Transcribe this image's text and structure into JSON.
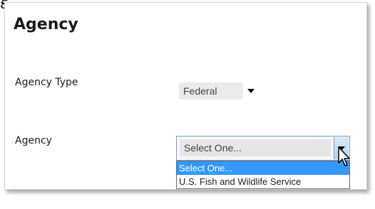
{
  "page": {
    "peek_text": "g"
  },
  "section": {
    "title": "Agency"
  },
  "agency_type": {
    "label": "Agency Type",
    "value": "Federal"
  },
  "agency": {
    "label": "Agency",
    "value": "Select One...",
    "options": [
      {
        "label": "Select One...",
        "selected": true
      },
      {
        "label": "U.S. Fish and Wildlife Service",
        "selected": false
      }
    ]
  },
  "colors": {
    "option_highlight": "#3399ff",
    "select_border": "#7a9cc6"
  },
  "icons": {
    "cursor": "mouse-pointer-icon",
    "type_arrow": "chevron-down-icon",
    "agency_arrow": "chevron-down-icon"
  }
}
